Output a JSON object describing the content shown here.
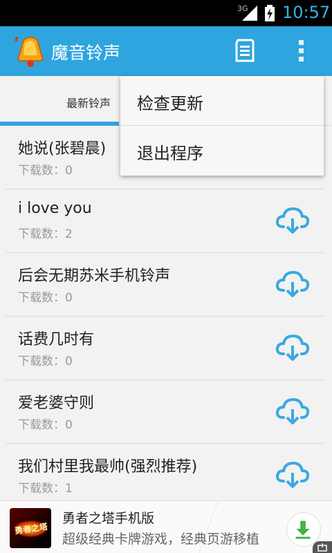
{
  "status_bar": {
    "network": "3G",
    "time": "10:57",
    "accent_color": "#33b5e5"
  },
  "action_bar": {
    "title": "魔音铃声",
    "logo_icon": "bell-icon",
    "sd_icon": "sd-card-icon",
    "overflow_icon": "overflow-menu-icon",
    "color": "#2ea5df"
  },
  "tabs": [
    {
      "label": "最新铃声",
      "selected": true
    }
  ],
  "overflow_menu": {
    "items": [
      {
        "label": "检查更新"
      },
      {
        "label": "退出程序"
      }
    ]
  },
  "ringtones": [
    {
      "name": "她说(张碧晨)",
      "count": "下载数：0"
    },
    {
      "name": "i love you",
      "count": "下载数：2"
    },
    {
      "name": "后会无期苏米手机铃声",
      "count": "下载数：0"
    },
    {
      "name": "话费几时有",
      "count": "下载数：0"
    },
    {
      "name": "爱老婆守则",
      "count": "下载数：0"
    },
    {
      "name": "我们村里我最帅(强烈推荐)",
      "count": "下载数：1"
    }
  ],
  "ad_banner": {
    "icon_text": "勇者之塔",
    "title": "勇者之塔手机版",
    "description": "超级经典卡牌游戏，经典页游移植",
    "download_icon": "download-icon",
    "badge_icon": "ad-badge-icon"
  }
}
